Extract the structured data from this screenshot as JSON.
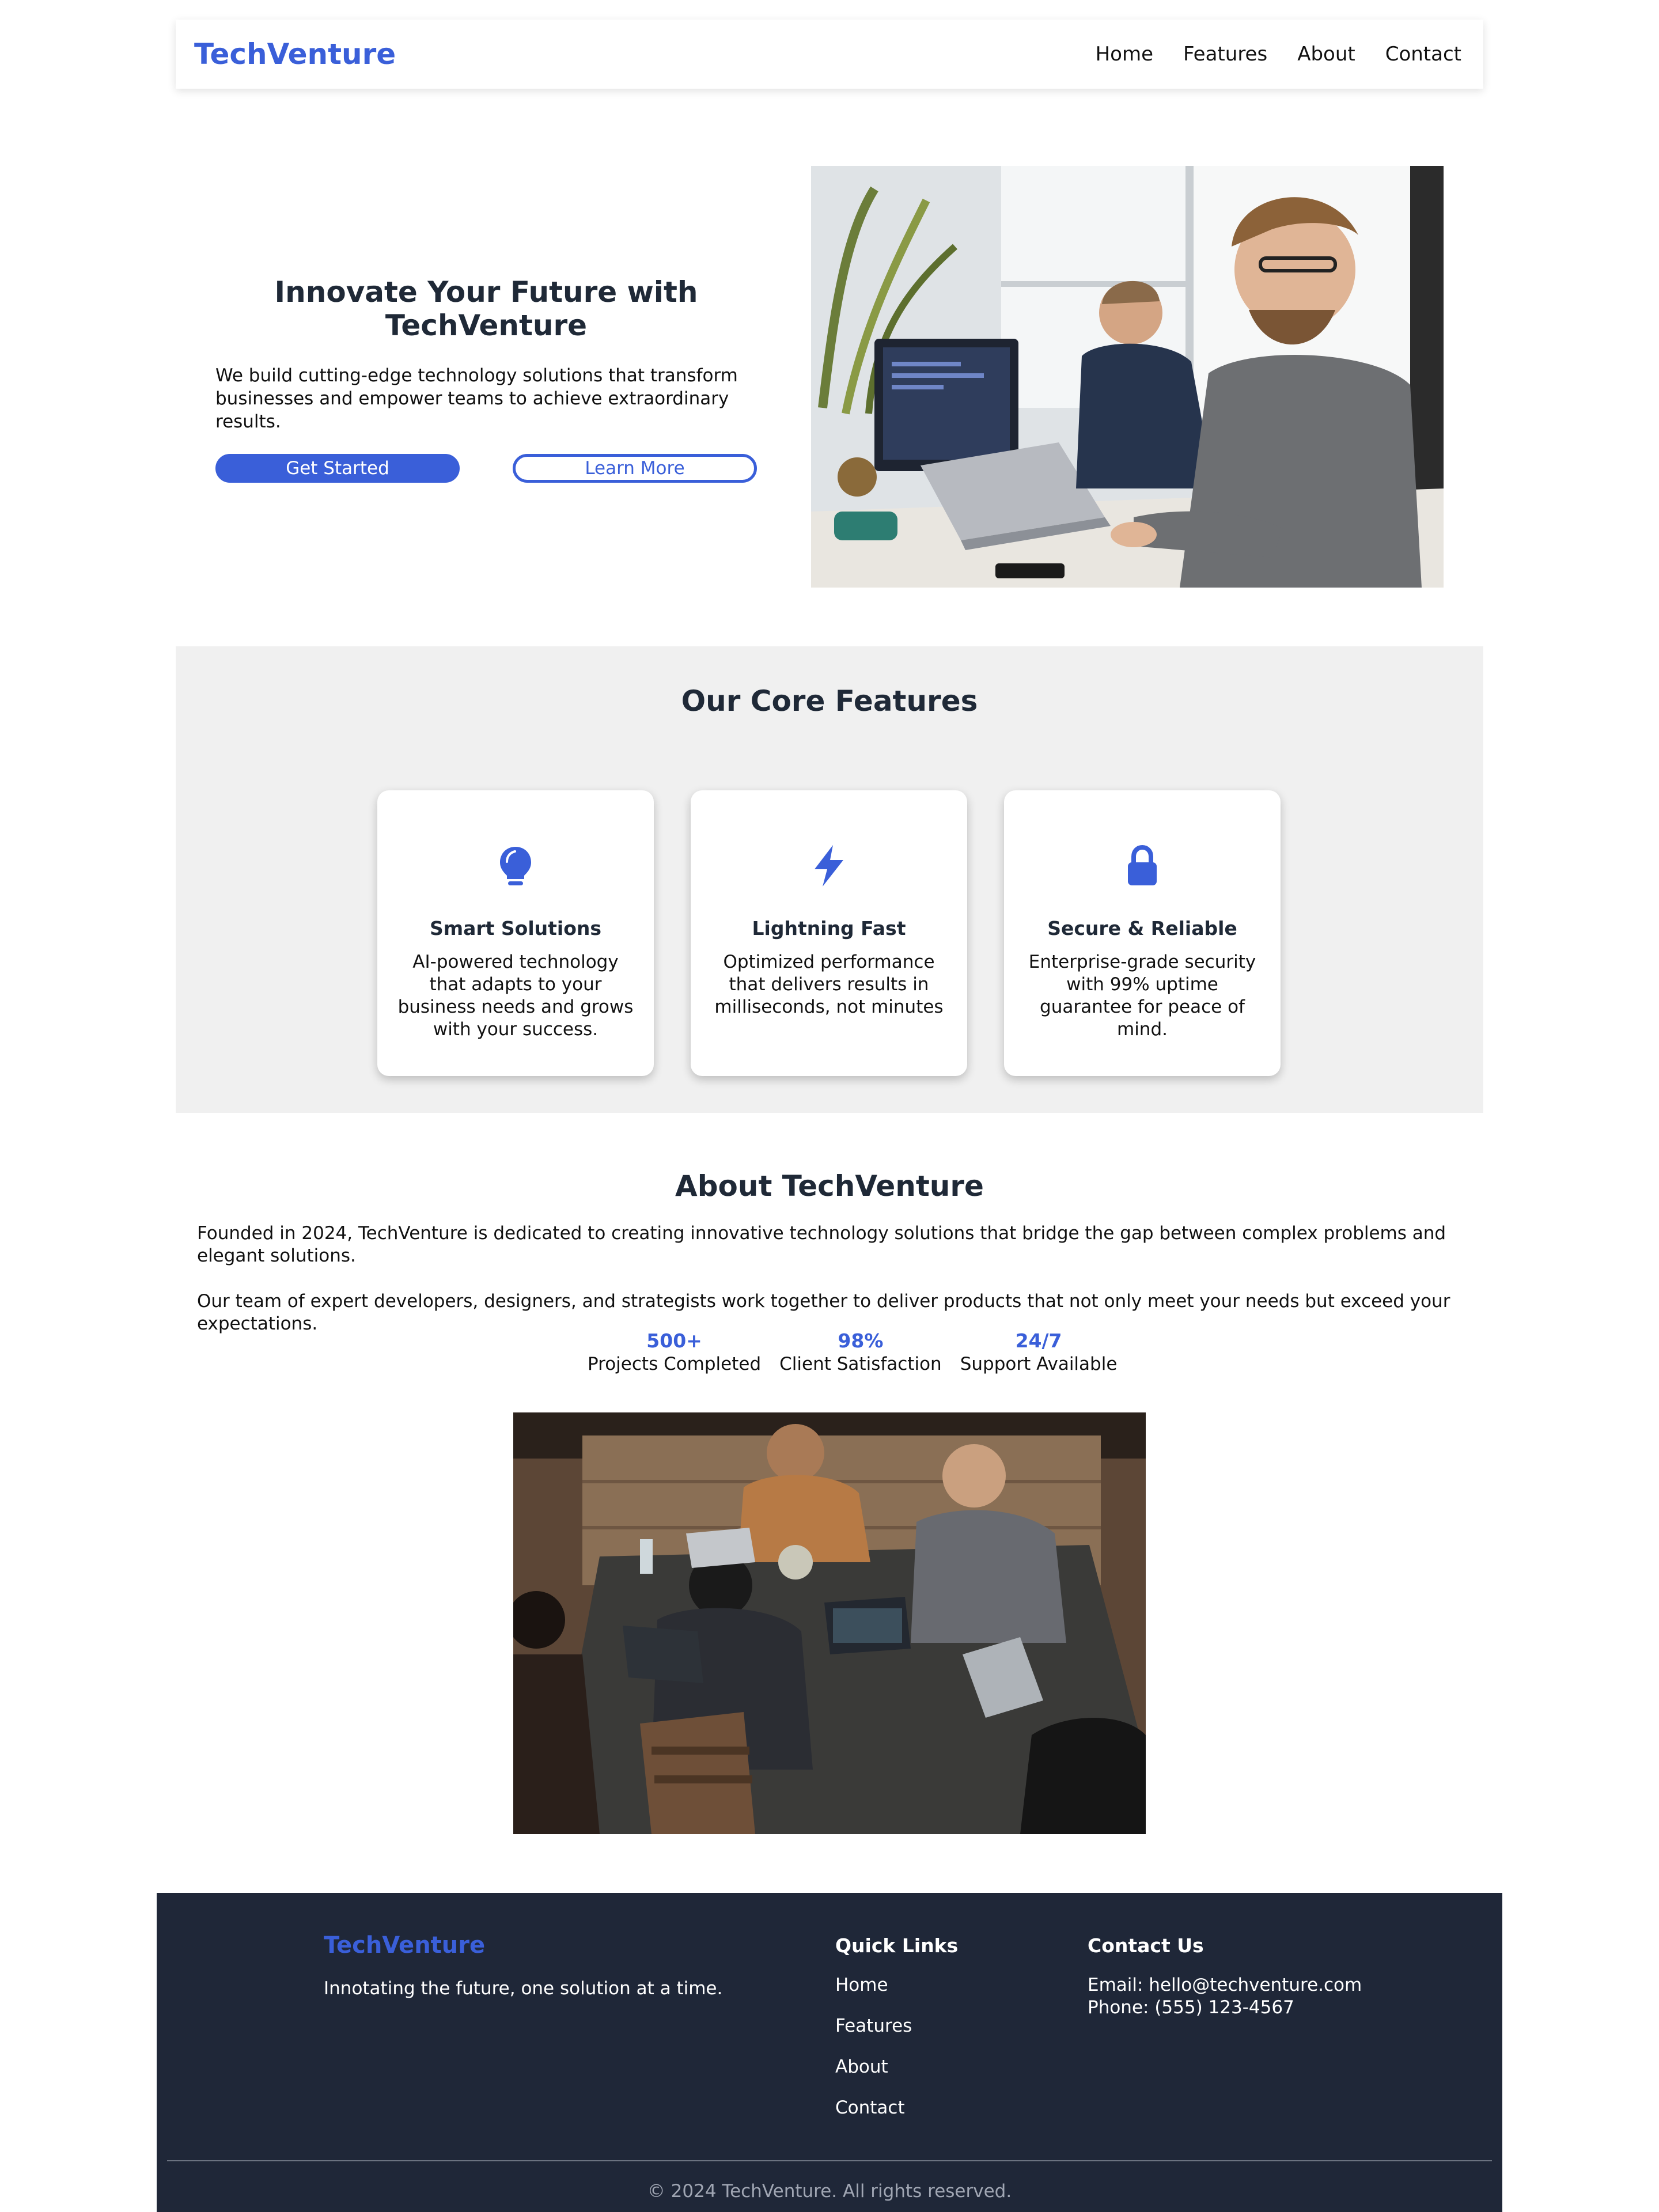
{
  "nav": {
    "logo": "TechVenture",
    "links": [
      "Home",
      "Features",
      "About",
      "Contact"
    ]
  },
  "hero": {
    "title": "Innovate Your Future with TechVenture",
    "description": "We build cutting-edge technology solutions that transform businesses and empower teams to achieve extraordinary results.",
    "primary_button": "Get Started",
    "secondary_button": "Learn More"
  },
  "features": {
    "title": "Our Core Features",
    "items": [
      {
        "icon": "lightbulb-icon",
        "title": "Smart Solutions",
        "description": "AI-powered technology that adapts to your business needs and grows with your success."
      },
      {
        "icon": "lightning-icon",
        "title": "Lightning Fast",
        "description": "Optimized performance that delivers results in milliseconds, not minutes"
      },
      {
        "icon": "lock-icon",
        "title": "Secure & Reliable",
        "description": "Enterprise-grade security with 99% uptime guarantee for peace of mind."
      }
    ]
  },
  "about": {
    "title": "About TechVenture",
    "paragraphs": [
      "Founded in 2024, TechVenture is dedicated to creating innovative technology solutions that bridge the gap between complex problems and elegant solutions.",
      "Our team of expert developers, designers, and strategists work together to deliver products that not only meet your needs but exceed your expectations."
    ],
    "stats": [
      {
        "value": "500+",
        "label": "Projects Completed"
      },
      {
        "value": "98%",
        "label": "Client Satisfaction"
      },
      {
        "value": "24/7",
        "label": "Support Available"
      }
    ]
  },
  "footer": {
    "logo": "TechVenture",
    "tagline": "Innotating the future, one solution at a time.",
    "quick_links_heading": "Quick Links",
    "quick_links": [
      "Home",
      "Features",
      "About",
      "Contact"
    ],
    "contact_heading": "Contact Us",
    "email": "Email: hello@techventure.com",
    "phone": "Phone: (555) 123-4567",
    "copyright": "© 2024 TechVenture. All rights reserved."
  },
  "colors": {
    "accent": "#3a5fd9",
    "heading": "#1f2937",
    "footer_bg": "#1f2738",
    "section_bg": "#f0f0f0"
  }
}
